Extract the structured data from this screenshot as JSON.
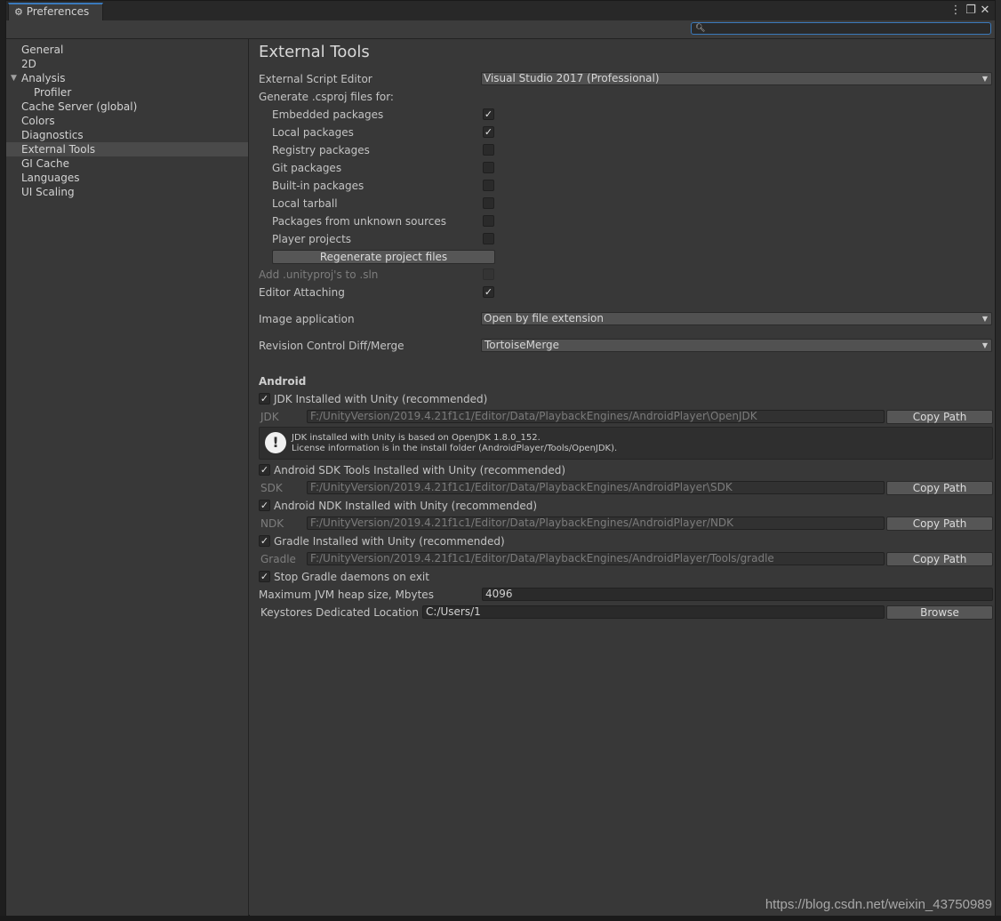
{
  "window": {
    "title": "Preferences",
    "menu_icon": "⋮",
    "max_icon": "❐",
    "close_icon": "✕"
  },
  "search": {
    "placeholder": ""
  },
  "sidebar": {
    "items": [
      {
        "label": "General"
      },
      {
        "label": "2D"
      },
      {
        "label": "Analysis"
      },
      {
        "label": "Profiler"
      },
      {
        "label": "Cache Server (global)"
      },
      {
        "label": "Colors"
      },
      {
        "label": "Diagnostics"
      },
      {
        "label": "External Tools"
      },
      {
        "label": "GI Cache"
      },
      {
        "label": "Languages"
      },
      {
        "label": "UI Scaling"
      }
    ]
  },
  "main": {
    "title": "External Tools",
    "script_editor": {
      "label": "External Script Editor",
      "value": "Visual Studio 2017 (Professional)"
    },
    "generate_label": "Generate .csproj files for:",
    "packages": [
      {
        "label": "Embedded packages",
        "checked": true
      },
      {
        "label": "Local packages",
        "checked": true
      },
      {
        "label": "Registry packages",
        "checked": false
      },
      {
        "label": "Git packages",
        "checked": false
      },
      {
        "label": "Built-in packages",
        "checked": false
      },
      {
        "label": "Local tarball",
        "checked": false
      },
      {
        "label": "Packages from unknown sources",
        "checked": false
      },
      {
        "label": "Player projects",
        "checked": false
      }
    ],
    "regenerate_label": "Regenerate project files",
    "add_unityproj": {
      "label": "Add .unityproj's to .sln",
      "checked": false
    },
    "editor_attaching": {
      "label": "Editor Attaching",
      "checked": true
    },
    "image_app": {
      "label": "Image application",
      "value": "Open by file extension"
    },
    "revision": {
      "label": "Revision Control Diff/Merge",
      "value": "TortoiseMerge"
    },
    "android": {
      "header": "Android",
      "jdk_check": {
        "label": "JDK Installed with Unity (recommended)",
        "checked": true
      },
      "jdk_label": "JDK",
      "jdk_path": "F:/UnityVersion/2019.4.21f1c1/Editor/Data/PlaybackEngines/AndroidPlayer\\OpenJDK",
      "help_line1": "JDK installed with Unity is based on OpenJDK 1.8.0_152.",
      "help_line2": "License information is in the install folder (AndroidPlayer/Tools/OpenJDK).",
      "sdk_check": {
        "label": "Android SDK Tools Installed with Unity (recommended)",
        "checked": true
      },
      "sdk_label": "SDK",
      "sdk_path": "F:/UnityVersion/2019.4.21f1c1/Editor/Data/PlaybackEngines/AndroidPlayer\\SDK",
      "ndk_check": {
        "label": "Android NDK Installed with Unity (recommended)",
        "checked": true
      },
      "ndk_label": "NDK",
      "ndk_path": "F:/UnityVersion/2019.4.21f1c1/Editor/Data/PlaybackEngines/AndroidPlayer/NDK",
      "gradle_check": {
        "label": "Gradle Installed with Unity (recommended)",
        "checked": true
      },
      "gradle_label": "Gradle",
      "gradle_path": "F:/UnityVersion/2019.4.21f1c1/Editor/Data/PlaybackEngines/AndroidPlayer/Tools/gradle",
      "stop_gradle": {
        "label": "Stop Gradle daemons on exit",
        "checked": true
      },
      "jvm_label": "Maximum JVM heap size, Mbytes",
      "jvm_value": "4096",
      "keystore_label": "Keystores Dedicated Location",
      "keystore_value": "C:/Users/1",
      "copy_path_label": "Copy Path",
      "browse_label": "Browse"
    }
  },
  "watermark": "https://blog.csdn.net/weixin_43750989",
  "colors": {
    "accent": "#3a79bb",
    "background": "#383838",
    "selected": "#4a4a4a"
  }
}
